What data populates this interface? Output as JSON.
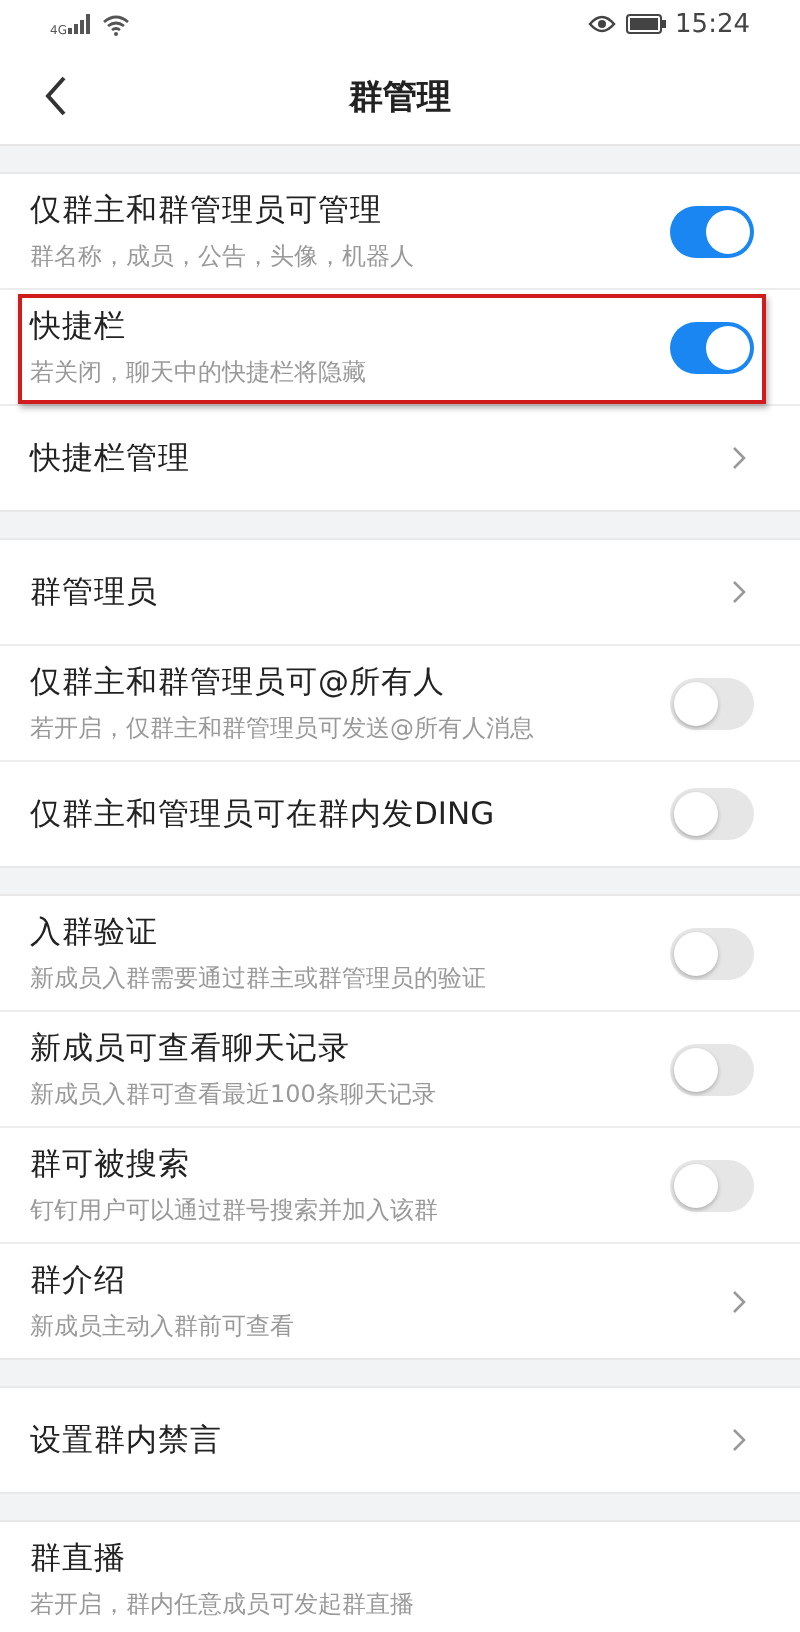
{
  "status_bar": {
    "network": "4G",
    "time": "15:24"
  },
  "header": {
    "title": "群管理"
  },
  "sections": [
    {
      "rows": [
        {
          "kind": "toggle",
          "title": "仅群主和群管理员可管理",
          "subtitle": "群名称，成员，公告，头像，机器人",
          "on": true,
          "highlighted": false
        },
        {
          "kind": "toggle",
          "title": "快捷栏",
          "subtitle": "若关闭，聊天中的快捷栏将隐藏",
          "on": true,
          "highlighted": true
        },
        {
          "kind": "link",
          "title": "快捷栏管理"
        }
      ]
    },
    {
      "rows": [
        {
          "kind": "link",
          "title": "群管理员"
        },
        {
          "kind": "toggle",
          "title": "仅群主和群管理员可@所有人",
          "subtitle": "若开启，仅群主和群管理员可发送@所有人消息",
          "on": false,
          "highlighted": false
        },
        {
          "kind": "toggle",
          "title": "仅群主和管理员可在群内发DING",
          "on": false,
          "highlighted": false
        }
      ]
    },
    {
      "rows": [
        {
          "kind": "toggle",
          "title": "入群验证",
          "subtitle": "新成员入群需要通过群主或群管理员的验证",
          "on": false,
          "highlighted": false
        },
        {
          "kind": "toggle",
          "title": "新成员可查看聊天记录",
          "subtitle": "新成员入群可查看最近100条聊天记录",
          "on": false,
          "highlighted": false
        },
        {
          "kind": "toggle",
          "title": "群可被搜索",
          "subtitle": "钉钉用户可以通过群号搜索并加入该群",
          "on": false,
          "highlighted": false
        },
        {
          "kind": "link",
          "title": "群介绍",
          "subtitle": "新成员主动入群前可查看"
        }
      ]
    },
    {
      "rows": [
        {
          "kind": "link",
          "title": "设置群内禁言"
        }
      ]
    },
    {
      "rows": [
        {
          "kind": "text",
          "title": "群直播",
          "subtitle": "若开启，群内任意成员可发起群直播"
        }
      ]
    }
  ]
}
